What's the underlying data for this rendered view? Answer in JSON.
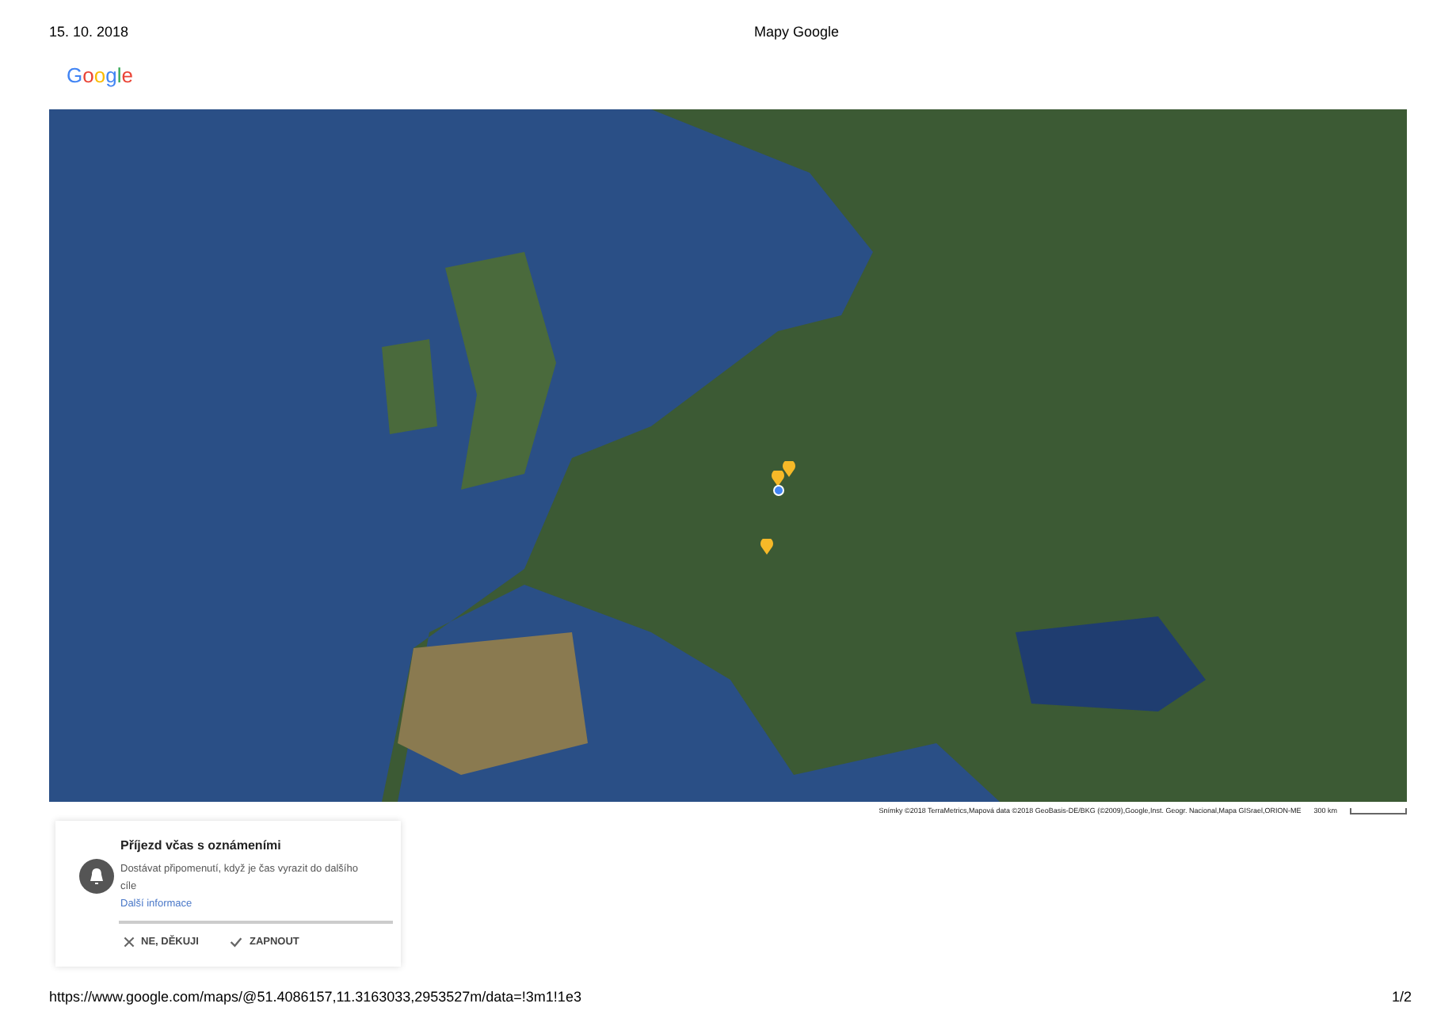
{
  "header": {
    "date": "15. 10. 2018",
    "title": "Mapy Google"
  },
  "logo": "Google",
  "map": {
    "attribution": "Snímky ©2018 TerraMetrics,Mapová data ©2018 GeoBasis-DE/BKG (©2009),Google,Inst. Geogr. Nacional,Mapa GISrael,ORION-ME",
    "scale": "300 km"
  },
  "notification": {
    "title": "Příjezd včas s oznámeními",
    "text": "Dostávat připomenutí, když je čas vyrazit do dalšího cíle",
    "link": "Další informace",
    "buttons": [
      {
        "kind": "dismiss",
        "label": "NE, DĚKUJI"
      },
      {
        "kind": "confirm",
        "label": "ZAPNOUT"
      }
    ]
  },
  "footer": {
    "url": "https://www.google.com/maps/@51.4086157,11.3163033,2953527m/data=!3m1!1e3",
    "page": "1/2"
  }
}
